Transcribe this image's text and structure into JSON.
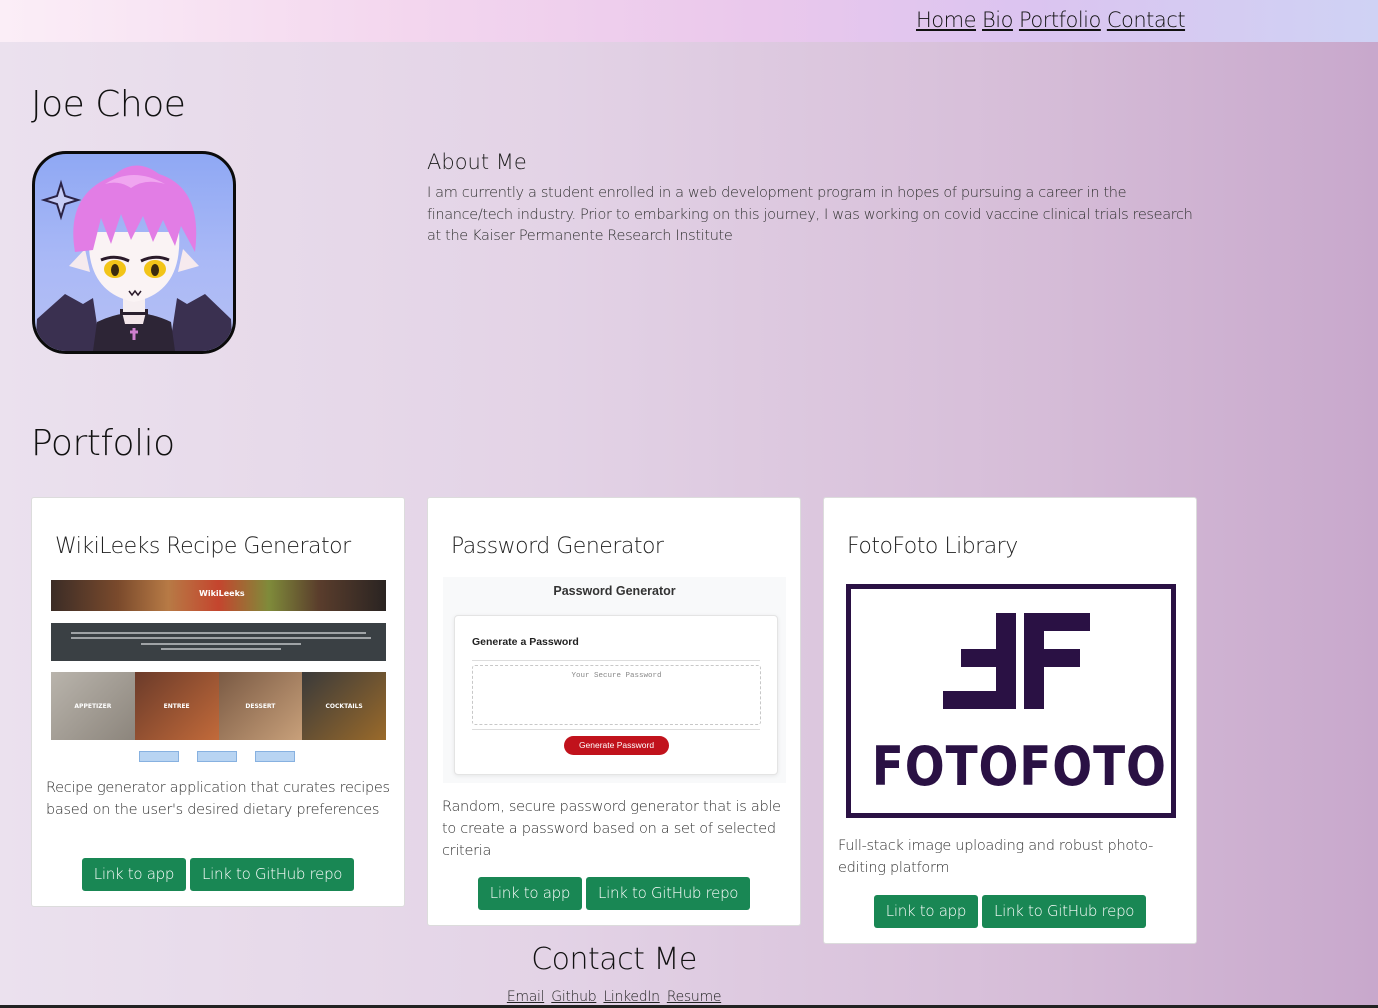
{
  "nav": {
    "home": "Home",
    "bio": "Bio",
    "portfolio": "Portfolio",
    "contact": "Contact"
  },
  "name": "Joe Choe",
  "about": {
    "heading": "About Me",
    "text": "I am currently a student enrolled in a web development program in hopes of pursuing a career in the finance/tech industry. Prior to embarking on this journey, I was working on covid vaccine clinical trials research at the Kaiser Permanente Research Institute"
  },
  "portfolio": {
    "heading": "Portfolio",
    "cards": [
      {
        "title": "WikiLeeks Recipe Generator",
        "description": "Recipe generator application that curates recipes based on the user's desired dietary preferences",
        "app_label": "Link to app",
        "repo_label": "Link to GitHub repo",
        "screenshot": {
          "banner": "WikiLeeks",
          "tiles": [
            "APPETIZER",
            "ENTREE",
            "DESSERT",
            "COCKTAILS"
          ]
        }
      },
      {
        "title": "Password Generator",
        "description": "Random, secure password generator that is able to create a password based on a set of selected criteria",
        "app_label": "Link to app",
        "repo_label": "Link to GitHub repo",
        "screenshot": {
          "title": "Password Generator",
          "card_heading": "Generate a Password",
          "placeholder": "Your Secure Password",
          "button": "Generate Password"
        }
      },
      {
        "title": "FotoFoto Library",
        "description": "Full-stack image uploading and robust photo-editing platform",
        "app_label": "Link to app",
        "repo_label": "Link to GitHub repo",
        "logo_text": "FOTOFOTO"
      }
    ]
  },
  "contact": {
    "heading": "Contact Me",
    "links": {
      "email": "Email",
      "github": "Github",
      "linkedin": "LinkedIn",
      "resume": "Resume"
    }
  },
  "colors": {
    "button_green": "#198754",
    "logo_purple": "#2a1144",
    "password_button_red": "#c1121c",
    "avatar_hair": "#e27de5"
  },
  "icons": [
    "avatar-image",
    "sparkle-icon"
  ]
}
